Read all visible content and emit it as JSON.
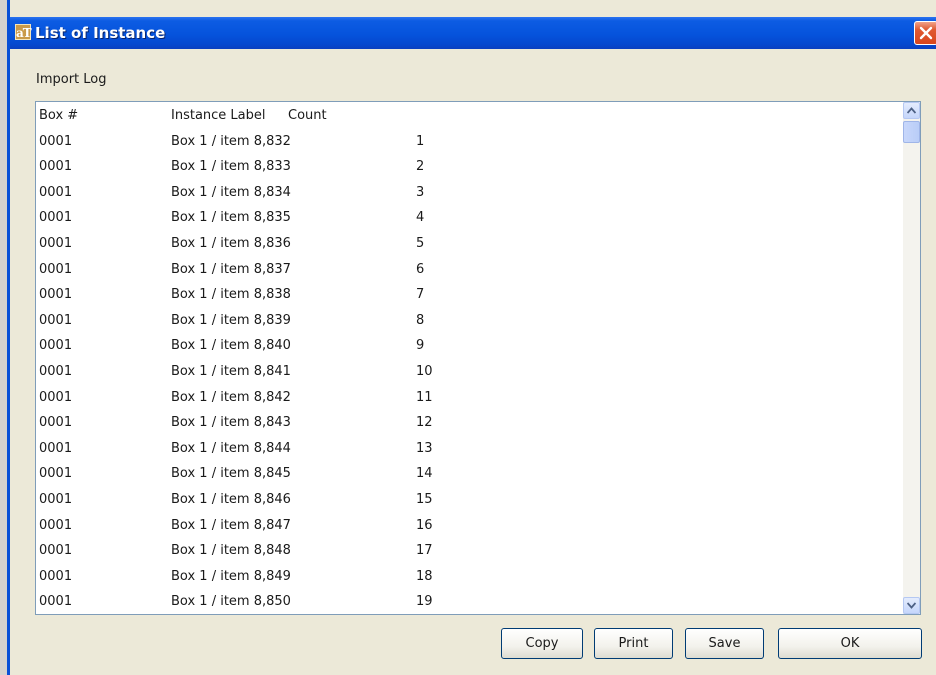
{
  "window": {
    "title": "List of Instance",
    "app_icon_text": "aT"
  },
  "import_log": {
    "label": "Import Log",
    "columns": [
      "Box #",
      "Instance Label",
      "Count"
    ],
    "rows": [
      {
        "box": "0001",
        "label": "Box 1 / item 8,832",
        "count": "1"
      },
      {
        "box": "0001",
        "label": "Box 1 / item 8,833",
        "count": "2"
      },
      {
        "box": "0001",
        "label": "Box 1 / item 8,834",
        "count": "3"
      },
      {
        "box": "0001",
        "label": "Box 1 / item 8,835",
        "count": "4"
      },
      {
        "box": "0001",
        "label": "Box 1 / item 8,836",
        "count": "5"
      },
      {
        "box": "0001",
        "label": "Box 1 / item 8,837",
        "count": "6"
      },
      {
        "box": "0001",
        "label": "Box 1 / item 8,838",
        "count": "7"
      },
      {
        "box": "0001",
        "label": "Box 1 / item 8,839",
        "count": "8"
      },
      {
        "box": "0001",
        "label": "Box 1 / item 8,840",
        "count": "9"
      },
      {
        "box": "0001",
        "label": "Box 1 / item 8,841",
        "count": "10"
      },
      {
        "box": "0001",
        "label": "Box 1 / item 8,842",
        "count": "11"
      },
      {
        "box": "0001",
        "label": "Box 1 / item 8,843",
        "count": "12"
      },
      {
        "box": "0001",
        "label": "Box 1 / item 8,844",
        "count": "13"
      },
      {
        "box": "0001",
        "label": "Box 1 / item 8,845",
        "count": "14"
      },
      {
        "box": "0001",
        "label": "Box 1 / item 8,846",
        "count": "15"
      },
      {
        "box": "0001",
        "label": "Box 1 / item 8,847",
        "count": "16"
      },
      {
        "box": "0001",
        "label": "Box 1 / item 8,848",
        "count": "17"
      },
      {
        "box": "0001",
        "label": "Box 1 / item 8,849",
        "count": "18"
      },
      {
        "box": "0001",
        "label": "Box 1 / item 8,850",
        "count": "19"
      }
    ]
  },
  "buttons": {
    "copy": "Copy",
    "print": "Print",
    "save": "Save",
    "ok": "OK"
  },
  "colors": {
    "titlebar": "#0553dc",
    "window_bg": "#ece9d8",
    "close_button": "#d9461d",
    "field_border": "#7f9db9"
  },
  "icons": {
    "app": "app-logo-icon",
    "close": "close-icon",
    "scroll_up": "scroll-up-arrow-icon",
    "scroll_down": "scroll-down-arrow-icon"
  }
}
